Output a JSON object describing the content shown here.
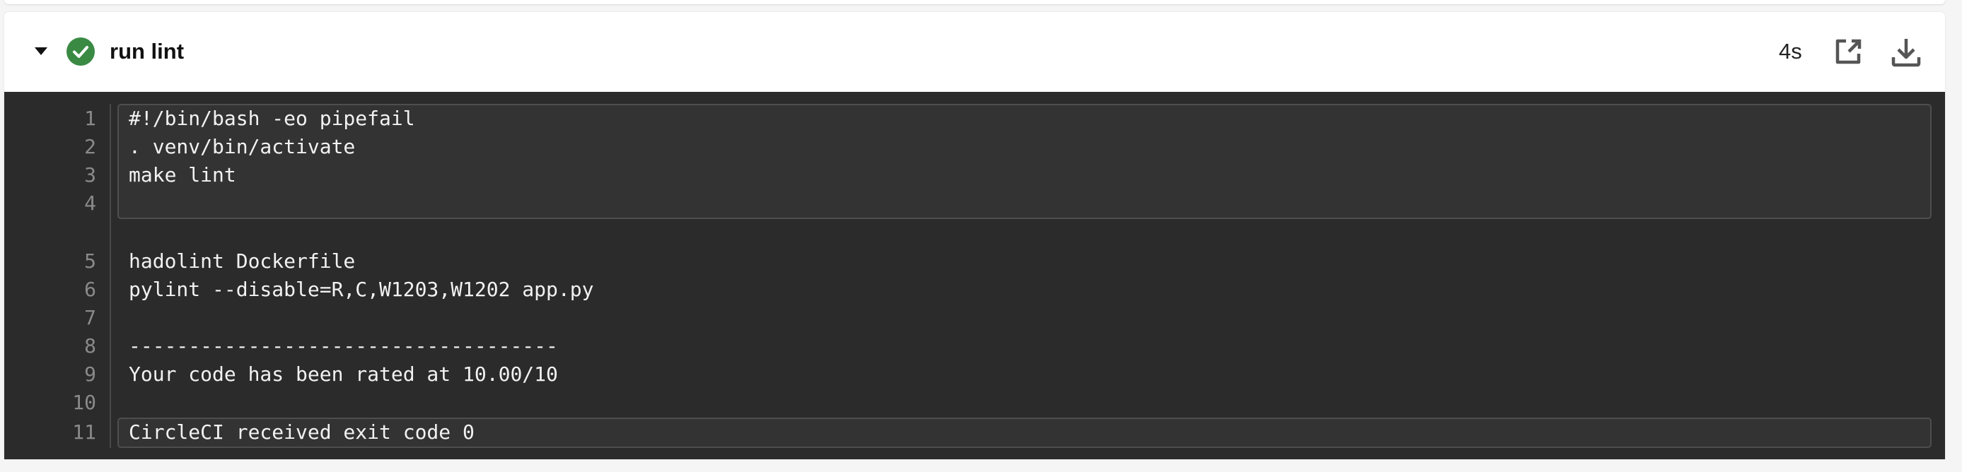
{
  "step": {
    "title": "run lint",
    "status": "success",
    "duration": "4s",
    "status_color": "#3a8a44",
    "icons": {
      "expand": "chevron-down-icon",
      "status": "check-circle-icon",
      "open": "open-external-icon",
      "download": "download-icon"
    }
  },
  "output": {
    "lines": [
      {
        "n": "1",
        "text": "#!/bin/bash -eo pipefail"
      },
      {
        "n": "2",
        "text": ". venv/bin/activate"
      },
      {
        "n": "3",
        "text": "make lint"
      },
      {
        "n": "4",
        "text": ""
      },
      {
        "n": "5",
        "text": "hadolint Dockerfile"
      },
      {
        "n": "6",
        "text": "pylint --disable=R,C,W1203,W1202 app.py"
      },
      {
        "n": "7",
        "text": ""
      },
      {
        "n": "8",
        "text": "------------------------------------"
      },
      {
        "n": "9",
        "text": "Your code has been rated at 10.00/10"
      },
      {
        "n": "10",
        "text": ""
      },
      {
        "n": "11",
        "text": "CircleCI received exit code 0"
      }
    ]
  }
}
